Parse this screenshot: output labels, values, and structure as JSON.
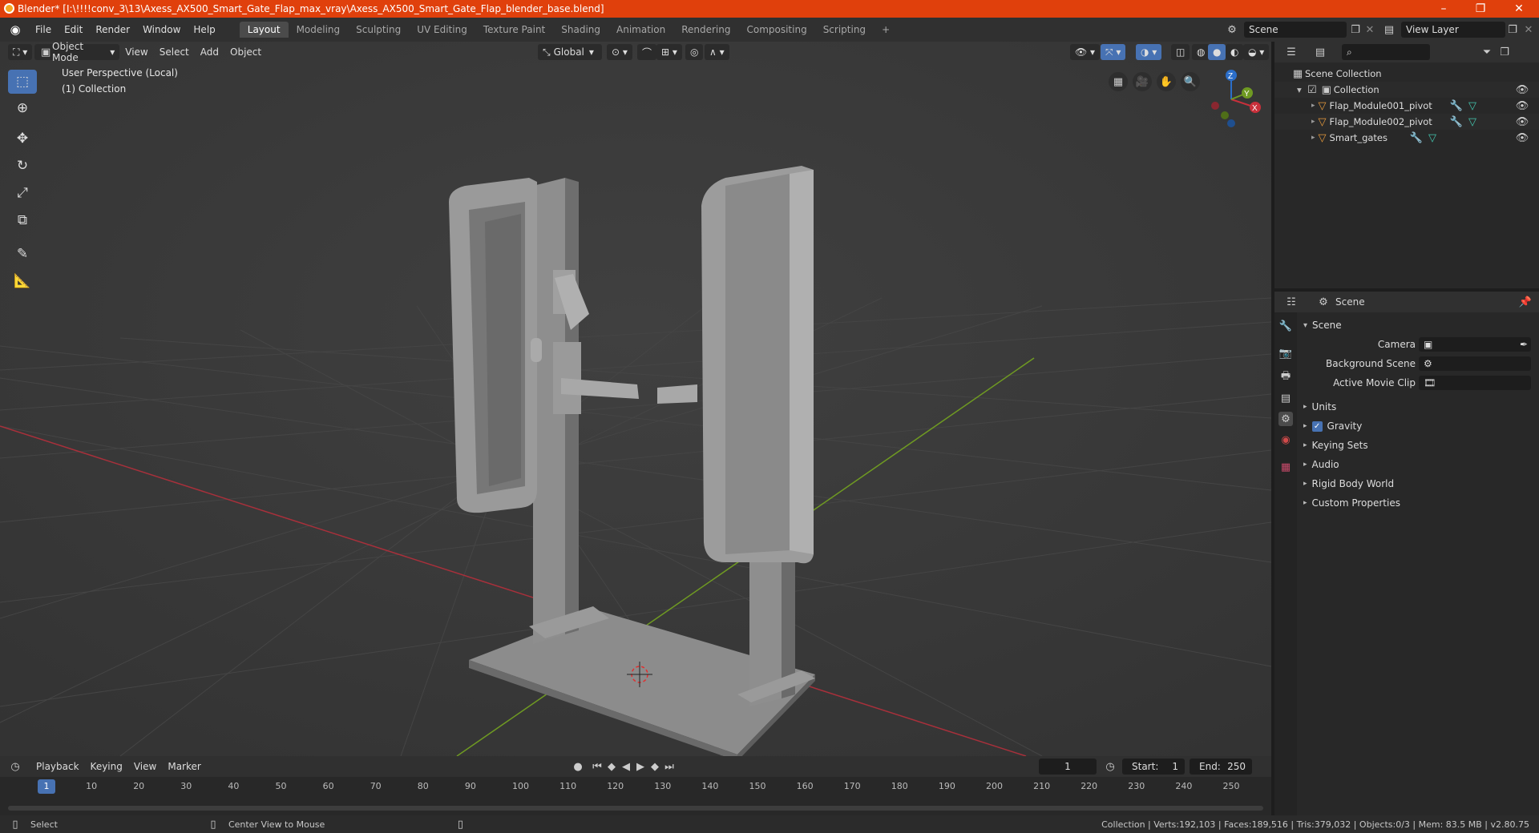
{
  "window": {
    "title": "Blender* [I:\\!!!!conv_3\\13\\Axess_AX500_Smart_Gate_Flap_max_vray\\Axess_AX500_Smart_Gate_Flap_blender_base.blend]",
    "minimize": "–",
    "maximize": "❐",
    "close": "✕"
  },
  "menu": {
    "file": "File",
    "edit": "Edit",
    "render": "Render",
    "window": "Window",
    "help": "Help"
  },
  "workspaces": [
    "Layout",
    "Modeling",
    "Sculpting",
    "UV Editing",
    "Texture Paint",
    "Shading",
    "Animation",
    "Rendering",
    "Compositing",
    "Scripting",
    "+"
  ],
  "scene_selector": "Scene",
  "view_layer": "View Layer",
  "viewport": {
    "mode": "Object Mode",
    "view": "View",
    "select": "Select",
    "add": "Add",
    "object": "Object",
    "orientation": "Global",
    "perspective_label": "User Perspective (Local)",
    "collection_label": "(1) Collection",
    "gizmo": {
      "x": "X",
      "y": "Y",
      "z": "Z"
    }
  },
  "outliner": {
    "search_placeholder": "",
    "scene_collection": "Scene Collection",
    "collection": "Collection",
    "items": [
      "Flap_Module001_pivot",
      "Flap_Module002_pivot",
      "Smart_gates"
    ]
  },
  "properties": {
    "breadcrumb": "Scene",
    "section": "Scene",
    "camera_label": "Camera",
    "background_scene_label": "Background Scene",
    "active_movie_clip_label": "Active Movie Clip",
    "panels": [
      "Units",
      "Gravity",
      "Keying Sets",
      "Audio",
      "Rigid Body World",
      "Custom Properties"
    ],
    "gravity_checked": true
  },
  "timeline": {
    "playback": "Playback",
    "keying": "Keying",
    "view": "View",
    "marker": "Marker",
    "current_frame": "1",
    "start_label": "Start:",
    "start": "1",
    "end_label": "End:",
    "end": "250",
    "ruler": [
      "10",
      "20",
      "30",
      "40",
      "50",
      "60",
      "70",
      "80",
      "90",
      "100",
      "110",
      "120",
      "130",
      "140",
      "150",
      "160",
      "170",
      "180",
      "190",
      "200",
      "210",
      "220",
      "230",
      "240",
      "250"
    ],
    "playhead": "1"
  },
  "statusbar": {
    "select": "Select",
    "center_view": "Center View to Mouse",
    "stats": "Collection | Verts:192,103 | Faces:189,516 | Tris:379,032 | Objects:0/3 | Mem: 83.5 MB | v2.80.75"
  },
  "colors": {
    "accent": "#4772b3",
    "titlebar": "#e0400c",
    "xaxis": "#a8303b",
    "yaxis": "#6f9a22"
  }
}
